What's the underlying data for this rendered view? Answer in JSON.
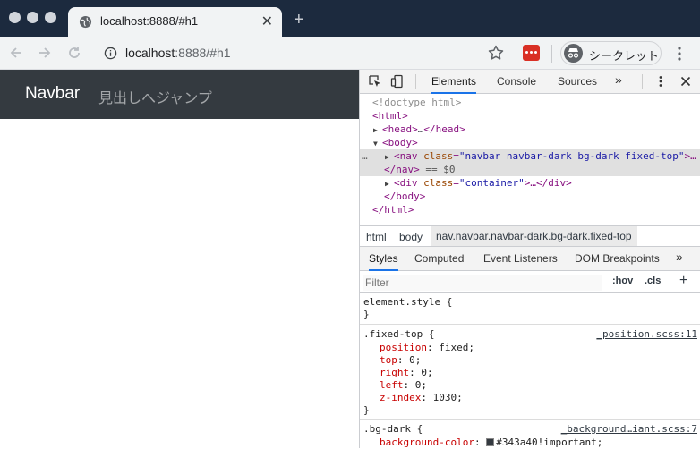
{
  "browser": {
    "tab": {
      "title": "localhost:8888/#h1",
      "close": "✕"
    },
    "new_tab": "+",
    "url_host": "localhost",
    "url_rest": ":8888/#h1",
    "profile_label": "シークレット"
  },
  "page": {
    "navbar": {
      "brand": "Navbar",
      "link": "見出しへジャンプ"
    }
  },
  "devtools": {
    "tabs": [
      "Elements",
      "Console",
      "Sources",
      "»"
    ],
    "dom": {
      "doctype": "<!doctype html>",
      "html_open": "<html>",
      "head_open": "<head>",
      "head_ellipsis": "…",
      "head_close": "</head>",
      "body_open": "<body>",
      "nav_open": "<nav",
      "nav_attr": "class",
      "nav_class": "\"navbar navbar-dark bg-dark fixed-top\"",
      "nav_trail": ">…",
      "row_dots": "…",
      "nav_close": "</nav>",
      "dollar": "== $0",
      "div_open": "<div",
      "div_attr": "class",
      "div_class": "\"container\"",
      "div_tail": ">…</div>",
      "body_close": "</body>",
      "html_close": "</html>"
    },
    "breadcrumbs": [
      "html",
      "body",
      "nav.navbar.navbar-dark.bg-dark.fixed-top"
    ],
    "sub_tabs": [
      "Styles",
      "Computed",
      "Event Listeners",
      "DOM Breakpoints",
      "»"
    ],
    "filter_placeholder": "Filter",
    "hov": ":hov",
    "cls": ".cls",
    "add": "+",
    "styles": {
      "element_style": "element.style {",
      "brace_close": "}",
      "fixed_top_selector": ".fixed-top {",
      "fixed_top_source": "_position.scss:11",
      "fixed_top_props": [
        {
          "name": "position",
          "value": "fixed;"
        },
        {
          "name": "top",
          "value": "0;"
        },
        {
          "name": "right",
          "value": "0;"
        },
        {
          "name": "left",
          "value": "0;"
        },
        {
          "name": "z-index",
          "value": "1030;"
        }
      ],
      "bg_dark_selector": ".bg-dark {",
      "bg_dark_source": "_background…iant.scss:7",
      "bg_dark_prop": {
        "name": "background-color",
        "value": "#343a40!important;"
      }
    }
  },
  "colors": {
    "navbar_bg": "#343a40",
    "chrome_frame": "#1c2a3e",
    "accent": "#1a73e8"
  }
}
